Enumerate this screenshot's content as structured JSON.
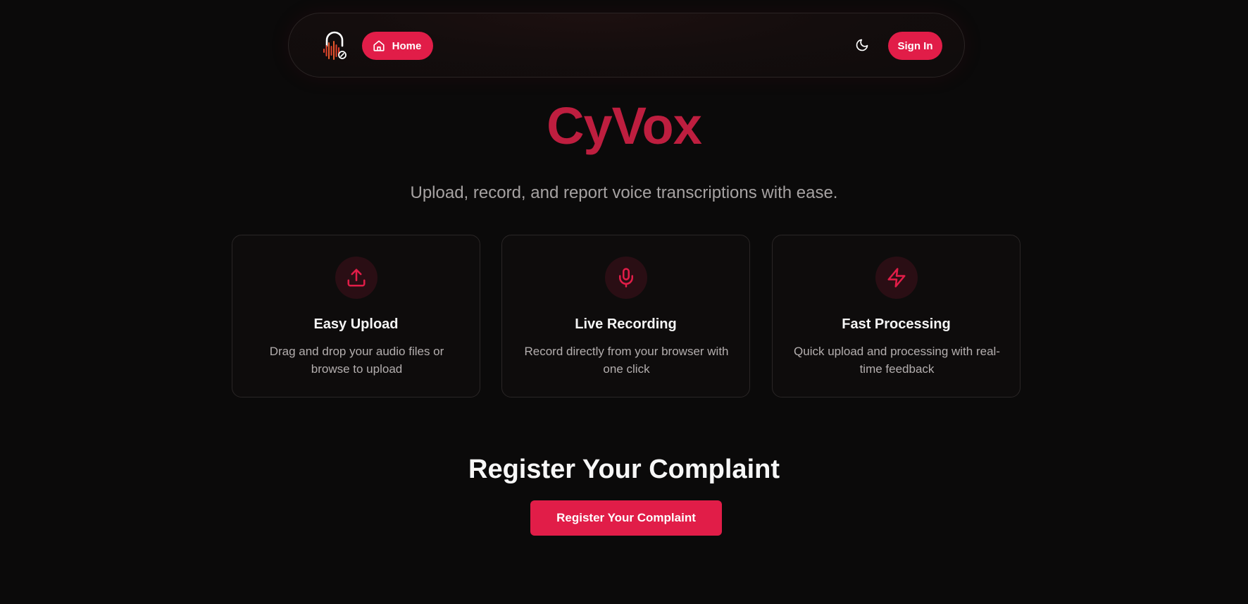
{
  "nav": {
    "home_label": "Home",
    "signin_label": "Sign In",
    "logo_icon": "headphones-waveform-icon",
    "home_icon": "home-icon",
    "theme_icon": "moon-icon"
  },
  "hero": {
    "title": "CyVox",
    "subtitle": "Upload, record, and report voice transcriptions with ease."
  },
  "features": [
    {
      "icon": "upload-icon",
      "title": "Easy Upload",
      "desc": "Drag and drop your audio files or browse to upload"
    },
    {
      "icon": "microphone-icon",
      "title": "Live Recording",
      "desc": "Record directly from your browser with one click"
    },
    {
      "icon": "lightning-icon",
      "title": "Fast Processing",
      "desc": "Quick upload and processing with real-time feedback"
    }
  ],
  "register": {
    "heading": "Register Your Complaint",
    "button_label": "Register Your Complaint"
  },
  "colors": {
    "accent": "#e11d48",
    "title": "#be1e3f",
    "background": "#0b0a0a"
  }
}
